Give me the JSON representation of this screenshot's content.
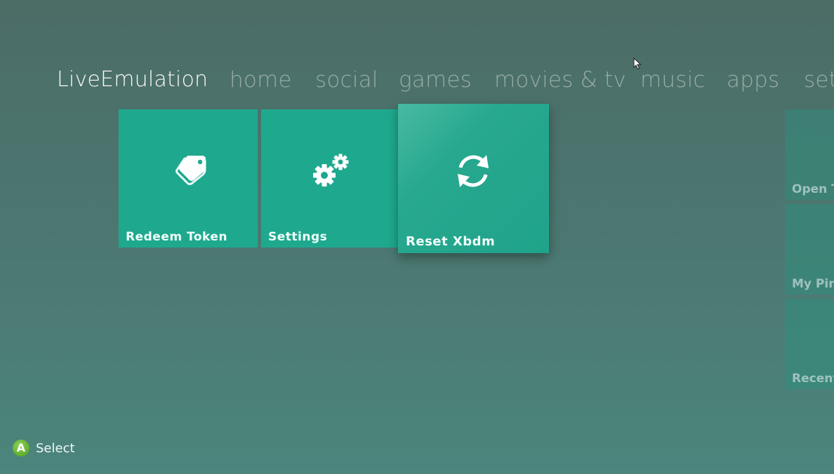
{
  "nav": {
    "items": [
      {
        "label": "LiveEmulation",
        "active": true
      },
      {
        "label": "home"
      },
      {
        "label": "social"
      },
      {
        "label": "games"
      },
      {
        "label": "movies & tv"
      },
      {
        "label": "music"
      },
      {
        "label": "apps"
      },
      {
        "label": "set"
      }
    ]
  },
  "tiles": [
    {
      "label": "Redeem Token",
      "icon": "tag-icon"
    },
    {
      "label": "Settings",
      "icon": "gears-icon"
    },
    {
      "label": "Reset Xbdm",
      "icon": "refresh-icon",
      "focused": true
    }
  ],
  "side_tiles": [
    {
      "label": "Open T"
    },
    {
      "label": "My Pin"
    },
    {
      "label": "Recent"
    }
  ],
  "hint": {
    "button": "A",
    "label": "Select"
  },
  "colors": {
    "tile": "#1ea98e",
    "a_button": "#5fae2c"
  }
}
